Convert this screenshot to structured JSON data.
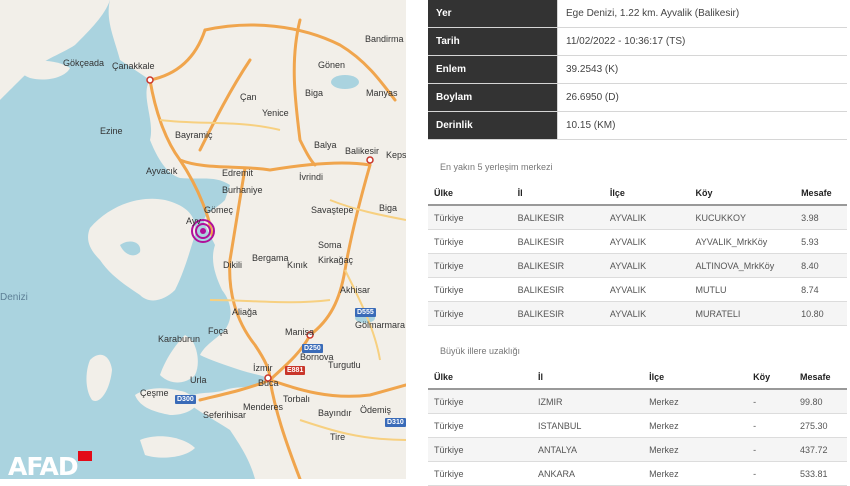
{
  "map": {
    "labels": {
      "gokceada": "Gökçeada",
      "canakkale": "Çanakkale",
      "bandirma": "Bandirma",
      "gonen": "Gönen",
      "manyas": "Manyas",
      "can": "Çan",
      "biga": "Biga",
      "ezine": "Ezine",
      "bayramic": "Bayramiç",
      "yenice": "Yenice",
      "balya": "Balya",
      "balikesir": "Balikesir",
      "kepsut": "Keps",
      "ayvacik": "Ayvacık",
      "edremit": "Edremit",
      "burhaniye": "Burhaniye",
      "ivrindi": "İvrindi",
      "gomec": "Gömeç",
      "savastepe": "Savaştepe",
      "bigadic": "Biga",
      "ayvalik": "Ayv",
      "soma": "Soma",
      "bergama": "Bergama",
      "dikili": "Dikili",
      "kinik": "Kınık",
      "kirkagac": "Kirkağaç",
      "akhisar": "Akhisar",
      "aliaga": "Aliağa",
      "golmarmara": "Gölmarmara",
      "foca": "Foça",
      "manisa": "Manisa",
      "karaburun": "Karaburun",
      "izmir": "İzmir",
      "turgutlu": "Turgutlu",
      "bornova": "Bornova",
      "buca": "Buca",
      "cesme": "Çeşme",
      "seferihisar": "Seferihisar",
      "menderes": "Menderes",
      "torbali": "Torbalı",
      "odemis": "Ödemiş",
      "bayindir": "Bayındır",
      "tire": "Tire",
      "urla": "Urla",
      "ege_denizi": "Denizi"
    },
    "roads": {
      "d555": "D555",
      "d250": "D250",
      "d300": "D300",
      "e881": "E881",
      "d310": "D310"
    },
    "logo": "AFAD"
  },
  "info": {
    "rows": [
      {
        "key": "Yer",
        "value": "Ege Denizi, 1.22 km. Ayvalik (Balikesir)"
      },
      {
        "key": "Tarih",
        "value": "11/02/2022 - 10:36:17 (TS)"
      },
      {
        "key": "Enlem",
        "value": "39.2543 (K)"
      },
      {
        "key": "Boylam",
        "value": "26.6950 (D)"
      },
      {
        "key": "Derinlik",
        "value": "10.15 (KM)"
      }
    ]
  },
  "nearest": {
    "title": "En yakın 5 yerleşim merkezi",
    "headers": [
      "Ülke",
      "İl",
      "İlçe",
      "Köy",
      "Mesafe"
    ],
    "rows": [
      [
        "Türkiye",
        "BALIKESIR",
        "AYVALIK",
        "KUCUKKOY",
        "3.98"
      ],
      [
        "Türkiye",
        "BALIKESIR",
        "AYVALIK",
        "AYVALIK_MrkKöy",
        "5.93"
      ],
      [
        "Türkiye",
        "BALIKESIR",
        "AYVALIK",
        "ALTINOVA_MrkKöy",
        "8.40"
      ],
      [
        "Türkiye",
        "BALIKESIR",
        "AYVALIK",
        "MUTLU",
        "8.74"
      ],
      [
        "Türkiye",
        "BALIKESIR",
        "AYVALIK",
        "MURATELI",
        "10.80"
      ]
    ]
  },
  "cities": {
    "title": "Büyük illere uzaklığı",
    "headers": [
      "Ülke",
      "İl",
      "İlçe",
      "Köy",
      "Mesafe"
    ],
    "rows": [
      [
        "Türkiye",
        "IZMIR",
        "Merkez",
        "-",
        "99.80"
      ],
      [
        "Türkiye",
        "ISTANBUL",
        "Merkez",
        "-",
        "275.30"
      ],
      [
        "Türkiye",
        "ANTALYA",
        "Merkez",
        "-",
        "437.72"
      ],
      [
        "Türkiye",
        "ANKARA",
        "Merkez",
        "-",
        "533.81"
      ]
    ]
  }
}
